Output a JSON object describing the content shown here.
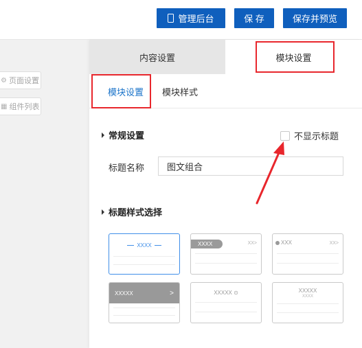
{
  "toolbar": {
    "admin_label": "管理后台",
    "save_label": "保 存",
    "preview_label": "保存并预览"
  },
  "sidebar": {
    "page_settings": "页面设置",
    "component_list": "组件列表"
  },
  "tabs": {
    "content_settings": "内容设置",
    "module_settings": "模块设置"
  },
  "subtabs": {
    "module_settings": "模块设置",
    "module_style": "模块样式"
  },
  "general": {
    "heading": "常规设置",
    "hide_title_label": "不显示标题",
    "title_name_label": "标题名称",
    "title_name_value": "图文组合"
  },
  "title_style": {
    "heading": "标题样式选择",
    "cards": [
      {
        "text": "XXXX",
        "more": ""
      },
      {
        "text": "XXXX",
        "more": "XX>"
      },
      {
        "text": "XXX",
        "more": "XX>"
      },
      {
        "text": "XXXXX",
        "more": ">"
      },
      {
        "text": "XXXXX ⊙",
        "more": ""
      },
      {
        "text": "XXXXX",
        "sub": "XXXX"
      }
    ]
  },
  "colors": {
    "primary": "#0f5fbd",
    "accent": "#1a73c9",
    "highlight": "#e8262c"
  }
}
